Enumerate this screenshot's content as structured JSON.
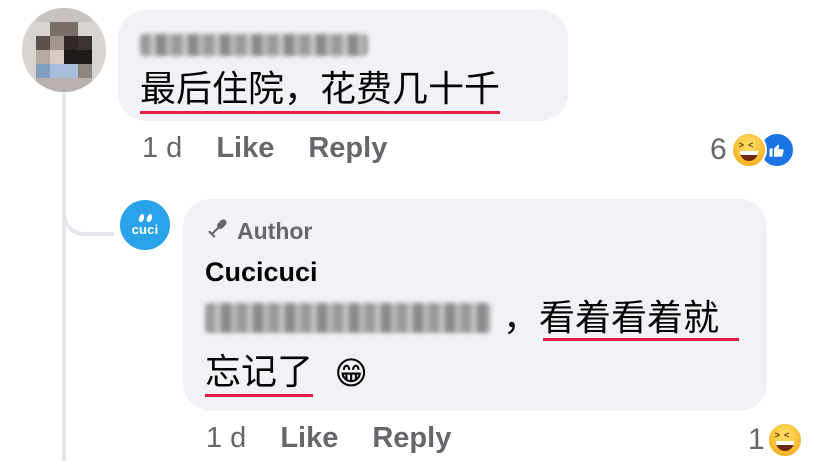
{
  "comment": {
    "text": "最后住院，花费几十千",
    "time": "1 d",
    "like_label": "Like",
    "reply_label": "Reply",
    "reaction_count": "6",
    "reactions": [
      "haha-icon",
      "like-icon"
    ]
  },
  "reply": {
    "author_badge": "Author",
    "display_name": "Cucicuci",
    "avatar_text": "cuci",
    "text_part1": "，看着看着就",
    "text_part2": "忘记了",
    "emoji": "😁",
    "time": "1 d",
    "like_label": "Like",
    "reply_label": "Reply",
    "reaction_count": "1",
    "reactions": [
      "haha-icon"
    ]
  },
  "colors": {
    "bubble": "#f0f2f5",
    "meta_text": "#65676b",
    "underline": "#e41e3f",
    "avatar_blue": "#2aa2e9"
  }
}
